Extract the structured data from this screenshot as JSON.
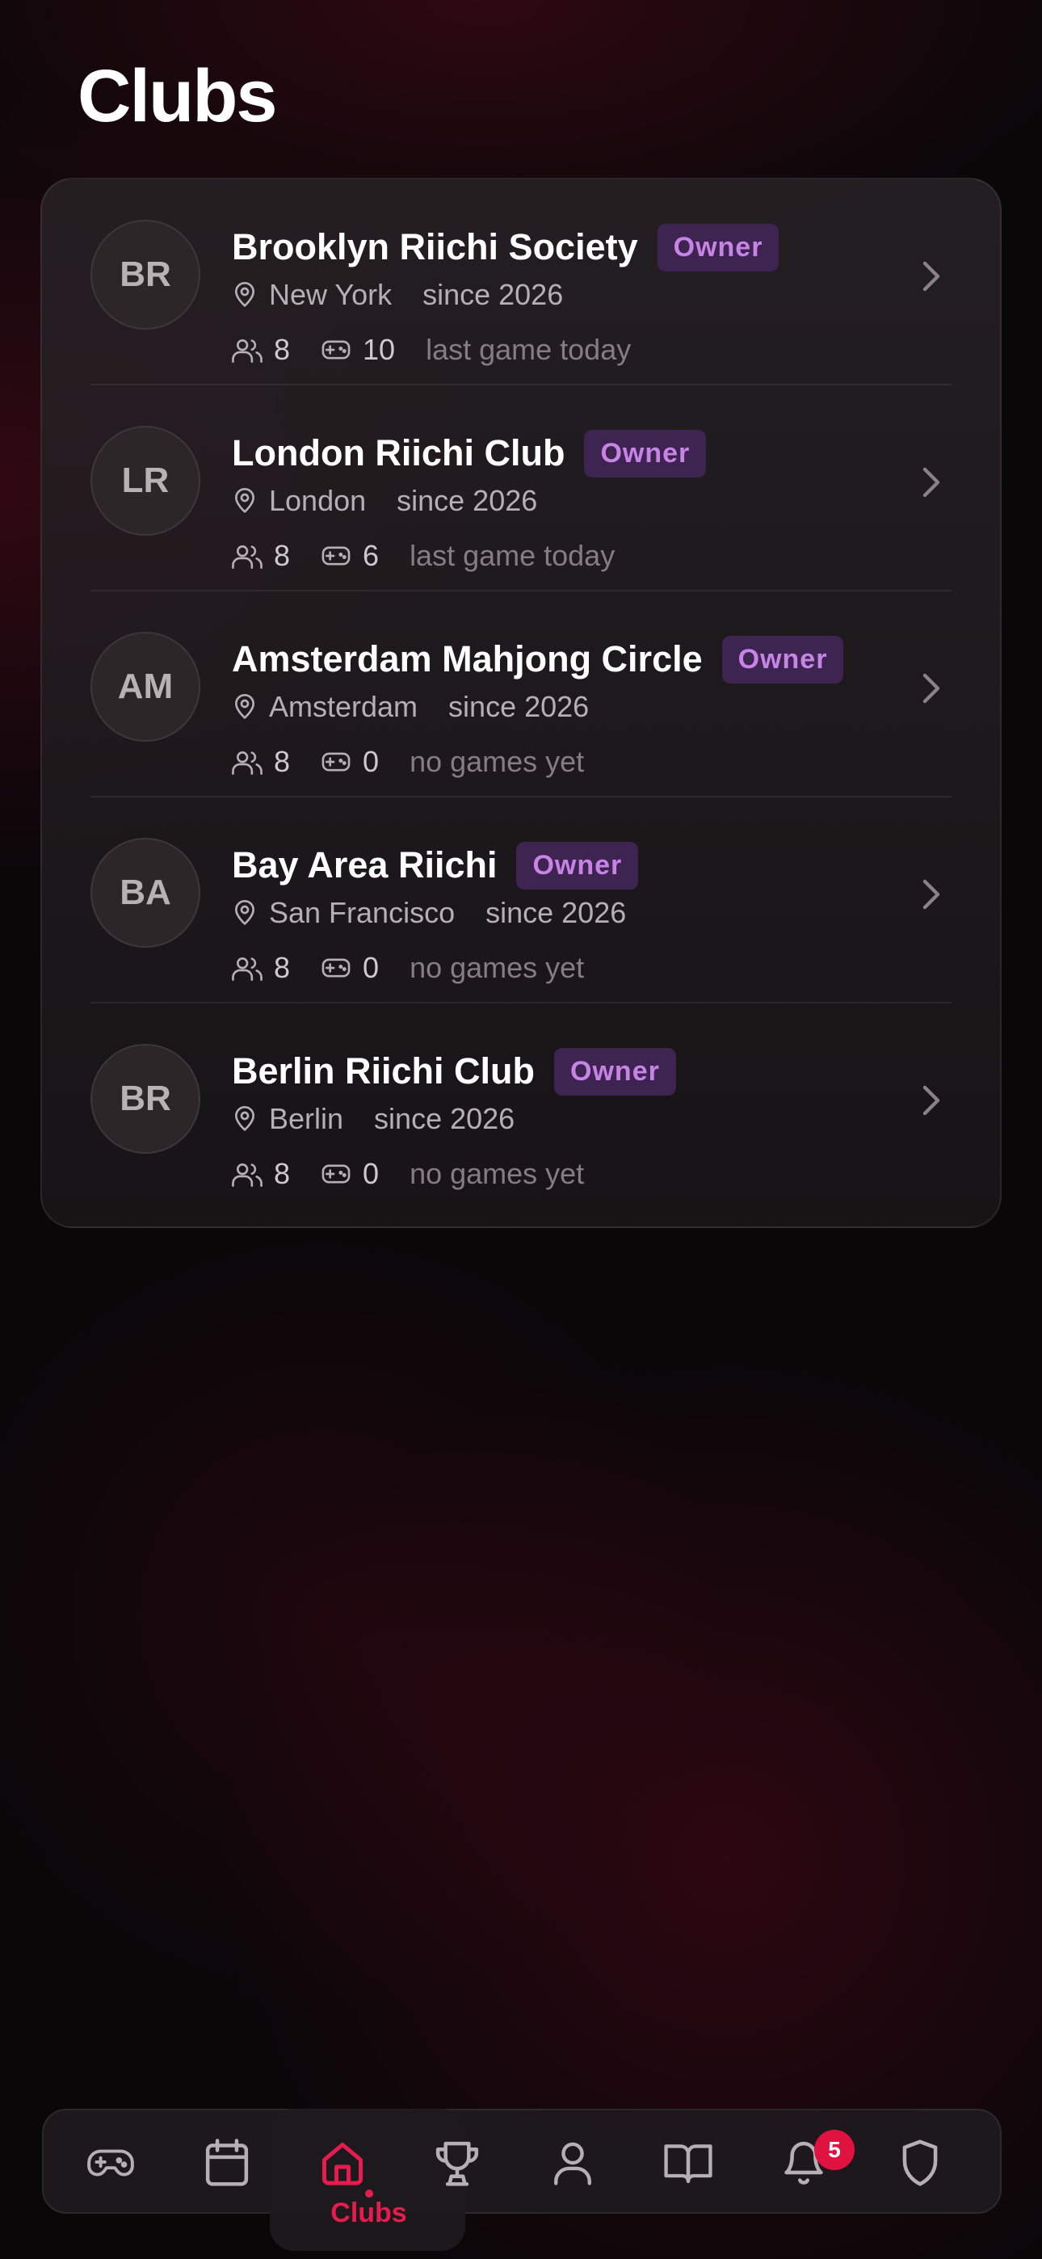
{
  "header": {
    "title": "Clubs"
  },
  "colors": {
    "accent": "#e51d4f",
    "badge_bg": "#3e2450",
    "badge_text": "#c784e6",
    "notification": "#e0123f"
  },
  "clubs": [
    {
      "initials": "BR",
      "name": "Brooklyn Riichi Society",
      "role": "Owner",
      "location": "New York",
      "since": "since 2026",
      "members": "8",
      "games": "10",
      "last_game": "last game today"
    },
    {
      "initials": "LR",
      "name": "London Riichi Club",
      "role": "Owner",
      "location": "London",
      "since": "since 2026",
      "members": "8",
      "games": "6",
      "last_game": "last game today"
    },
    {
      "initials": "AM",
      "name": "Amsterdam Mahjong Circle",
      "role": "Owner",
      "location": "Amsterdam",
      "since": "since 2026",
      "members": "8",
      "games": "0",
      "last_game": "no games yet"
    },
    {
      "initials": "BA",
      "name": "Bay Area Riichi",
      "role": "Owner",
      "location": "San Francisco",
      "since": "since 2026",
      "members": "8",
      "games": "0",
      "last_game": "no games yet"
    },
    {
      "initials": "BR",
      "name": "Berlin Riichi Club",
      "role": "Owner",
      "location": "Berlin",
      "since": "since 2026",
      "members": "8",
      "games": "0",
      "last_game": "no games yet"
    }
  ],
  "tab_bar": {
    "items": [
      {
        "icon": "gamepad-icon"
      },
      {
        "icon": "calendar-icon"
      },
      {
        "icon": "home-icon",
        "label": "Clubs",
        "active": true
      },
      {
        "icon": "trophy-icon"
      },
      {
        "icon": "user-icon"
      },
      {
        "icon": "book-icon"
      },
      {
        "icon": "bell-icon",
        "badge": "5"
      },
      {
        "icon": "shield-icon"
      }
    ],
    "active_label": "Clubs",
    "notification_count": "5"
  }
}
